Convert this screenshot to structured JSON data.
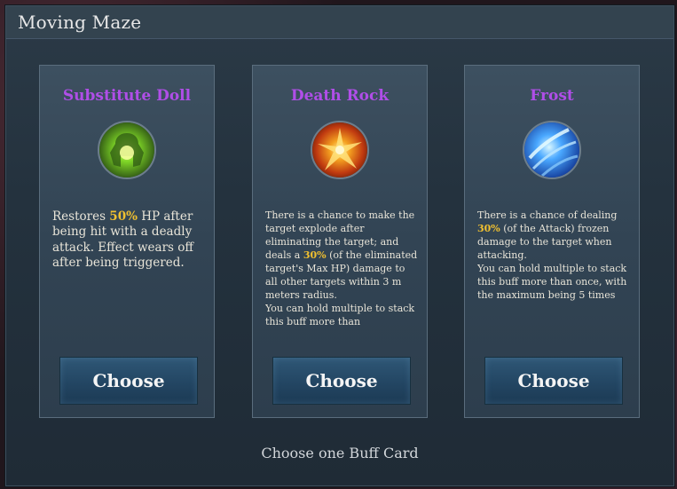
{
  "window": {
    "title": "Moving Maze"
  },
  "cards": [
    {
      "name": "Substitute Doll",
      "icon": "substitute-doll-icon",
      "desc_parts": [
        "Restores ",
        "50%",
        " HP after being hit with a deadly attack. Effect wears off after being triggered."
      ],
      "button": "Choose"
    },
    {
      "name": "Death Rock",
      "icon": "death-rock-icon",
      "desc_parts": [
        "There is a chance to make the target explode after eliminating the target; and deals a ",
        "30%",
        " (of the eliminated target's Max HP) damage to all other targets within 3 m meters radius.\nYou can hold multiple to stack this buff more than"
      ],
      "button": "Choose"
    },
    {
      "name": "Frost",
      "icon": "frost-icon",
      "desc_parts": [
        "There is a chance of dealing ",
        "30%",
        " (of the Attack) frozen damage to the target when attacking.\nYou can hold multiple to stack this buff more than once, with the maximum being 5 times"
      ],
      "button": "Choose"
    }
  ],
  "footer": {
    "text": "Choose one Buff Card"
  },
  "colors": {
    "card_name": "#b04ee8",
    "highlight": "#f0c030"
  }
}
